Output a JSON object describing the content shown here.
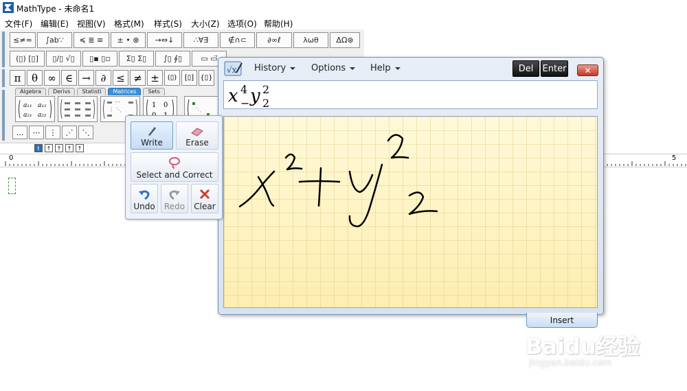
{
  "window": {
    "title": "MathType - 未命名1"
  },
  "menubar": [
    {
      "label": "文件(F)"
    },
    {
      "label": "编辑(E)"
    },
    {
      "label": "视图(V)"
    },
    {
      "label": "格式(M)"
    },
    {
      "label": "样式(S)"
    },
    {
      "label": "大小(Z)"
    },
    {
      "label": "选项(O)"
    },
    {
      "label": "帮助(H)"
    }
  ],
  "toolbar_row1": [
    "≤≠≈",
    "∫ab∵",
    "≼ ≣ ≡",
    "± • ⊗",
    "→⇔↓",
    "∴∀∃",
    "∉∩⊂",
    "∂∞ℓ",
    "λωθ",
    "ΔΩ⊛"
  ],
  "toolbar_row2": [
    "(▯) [▯]",
    "▯/▯ √▯",
    "▯▪ ▯▫",
    "Σ▯ Σ▯",
    "∫▯ ∮▯",
    "▭ ▭⃗"
  ],
  "symbols_row": [
    "π",
    "θ",
    "∞",
    "∈",
    "→",
    "∂",
    "≤",
    "≠",
    "±",
    "(▯)",
    "[▯]",
    "{▯}"
  ],
  "palette_tabs": [
    {
      "label": "Algebra",
      "active": false
    },
    {
      "label": "Derivs",
      "active": false
    },
    {
      "label": "Statisti",
      "active": false
    },
    {
      "label": "Matrices",
      "active": true
    },
    {
      "label": "Sets",
      "active": false
    }
  ],
  "small_buttons": [
    "...",
    "⋯",
    "⋮",
    "⋰",
    "⋱"
  ],
  "ruler": {
    "start": "0",
    "end": "5"
  },
  "math_input": {
    "menus": [
      {
        "label": "History"
      },
      {
        "label": "Options"
      },
      {
        "label": "Help"
      }
    ],
    "del_label": "Del",
    "enter_label": "Enter",
    "close_label": "✕",
    "preview": {
      "base1": "x",
      "sup1": "4",
      "sub1": "−",
      "base2": "y",
      "sup2": "2",
      "sub2": "2"
    },
    "insert_label": "Insert"
  },
  "tool_pane": {
    "write_label": "Write",
    "erase_label": "Erase",
    "select_label": "Select and Correct",
    "undo_label": "Undo",
    "redo_label": "Redo",
    "clear_label": "Clear"
  },
  "watermark": {
    "brand": "Baidu经验",
    "site": "jingyan.baidu.com"
  },
  "colors": {
    "accent": "#2a6fb0",
    "canvas": "#fef9d6",
    "ink": "#000000",
    "eraser": "#d9577a"
  }
}
